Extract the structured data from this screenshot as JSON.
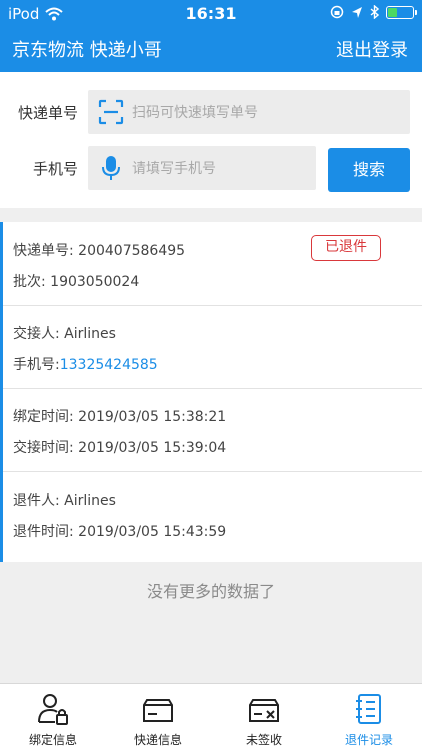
{
  "status_bar": {
    "carrier": "iPod",
    "time": "16:31"
  },
  "nav": {
    "title": "京东物流  快递小哥",
    "logout": "退出登录"
  },
  "search": {
    "tracking_label": "快递单号",
    "tracking_placeholder": "扫码可快速填写单号",
    "phone_label": "手机号",
    "phone_placeholder": "请填写手机号",
    "search_button": "搜索"
  },
  "record": {
    "tracking_label": "快递单号:",
    "tracking_value": "200407586495",
    "status": "已退件",
    "batch_label": "批次:",
    "batch_value": "1903050024",
    "handover_label": "交接人:",
    "handover_value": "Airlines",
    "phone_label": "手机号:",
    "phone_value": "13325424585",
    "bind_time_label": "绑定时间:",
    "bind_time_value": "2019/03/05 15:38:21",
    "handover_time_label": "交接时间:",
    "handover_time_value": "2019/03/05 15:39:04",
    "returner_label": "退件人:",
    "returner_value": "Airlines",
    "return_time_label": "退件时间:",
    "return_time_value": "2019/03/05 15:43:59"
  },
  "no_more": "没有更多的数据了",
  "tabs": [
    {
      "label": "绑定信息",
      "icon": "user-lock-icon",
      "active": false
    },
    {
      "label": "快递信息",
      "icon": "package-icon",
      "active": false
    },
    {
      "label": "未签收",
      "icon": "package-x-icon",
      "active": false
    },
    {
      "label": "退件记录",
      "icon": "notebook-icon",
      "active": true
    }
  ],
  "colors": {
    "primary": "#1b8de6",
    "badge": "#d9383b",
    "battery": "#4cd964"
  }
}
